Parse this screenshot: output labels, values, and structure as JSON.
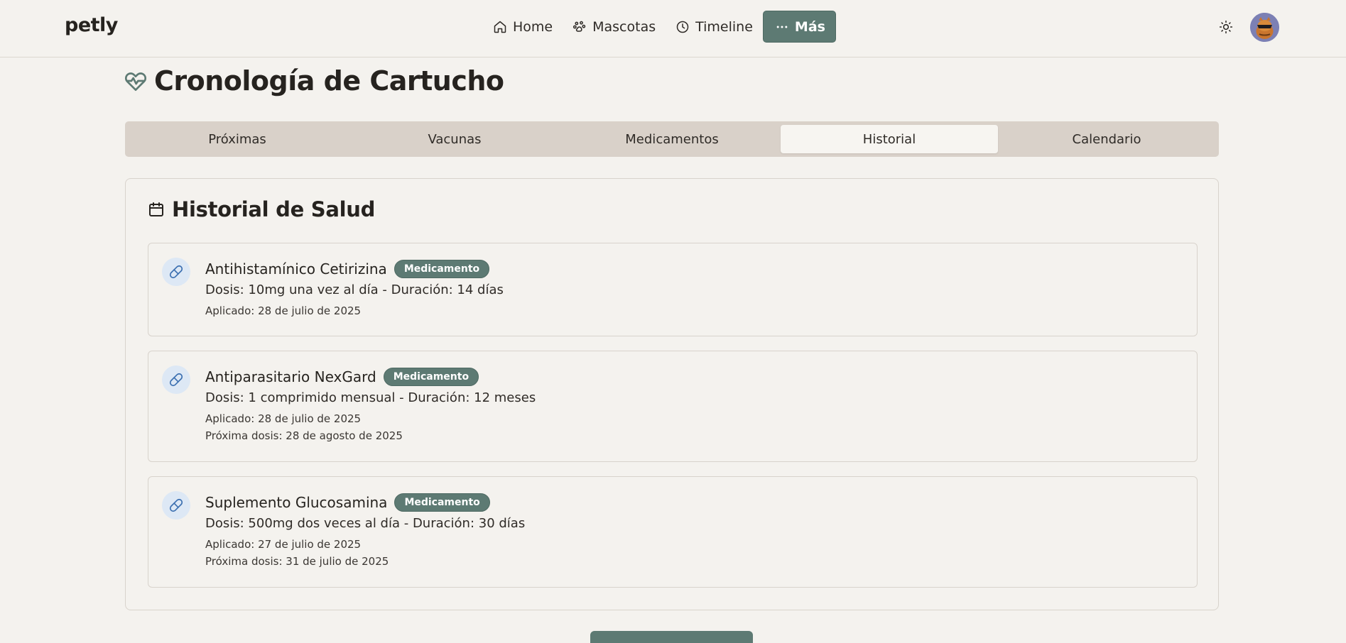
{
  "app": {
    "logo": "petly"
  },
  "nav": {
    "items": [
      {
        "label": "Home",
        "icon": "home-icon"
      },
      {
        "label": "Mascotas",
        "icon": "paw-icon"
      },
      {
        "label": "Timeline",
        "icon": "clock-icon"
      },
      {
        "label": "Más",
        "icon": "more-dots-icon"
      }
    ],
    "active": "Más"
  },
  "header": {
    "theme_toggle": "sun-icon",
    "avatar": "user-avatar"
  },
  "page": {
    "title": "Cronología de Cartucho",
    "title_icon": "heart-pulse-icon"
  },
  "tabs": {
    "items": [
      "Próximas",
      "Vacunas",
      "Medicamentos",
      "Historial",
      "Calendario"
    ],
    "active": "Historial"
  },
  "history": {
    "title": "Historial de Salud",
    "title_icon": "calendar-icon",
    "entries": [
      {
        "name": "Antihistamínico Cetirizina",
        "badge": "Medicamento",
        "dose": "Dosis: 10mg una vez al día - Duración: 14 días",
        "applied": "Aplicado: 28 de julio de 2025",
        "next": ""
      },
      {
        "name": "Antiparasitario NexGard",
        "badge": "Medicamento",
        "dose": "Dosis: 1 comprimido mensual - Duración: 12 meses",
        "applied": "Aplicado: 28 de julio de 2025",
        "next": "Próxima dosis: 28 de agosto de 2025"
      },
      {
        "name": "Suplemento Glucosamina",
        "badge": "Medicamento",
        "dose": "Dosis: 500mg dos veces al día - Duración: 30 días",
        "applied": "Aplicado: 27 de julio de 2025",
        "next": "Próxima dosis: 31 de julio de 2025"
      }
    ]
  },
  "colors": {
    "accent": "#5d7a73",
    "background": "#f4f2ee",
    "tabs_bg": "#d9d1c9",
    "icon_bg": "#dde8f5",
    "icon_stroke": "#3b6fb0"
  }
}
